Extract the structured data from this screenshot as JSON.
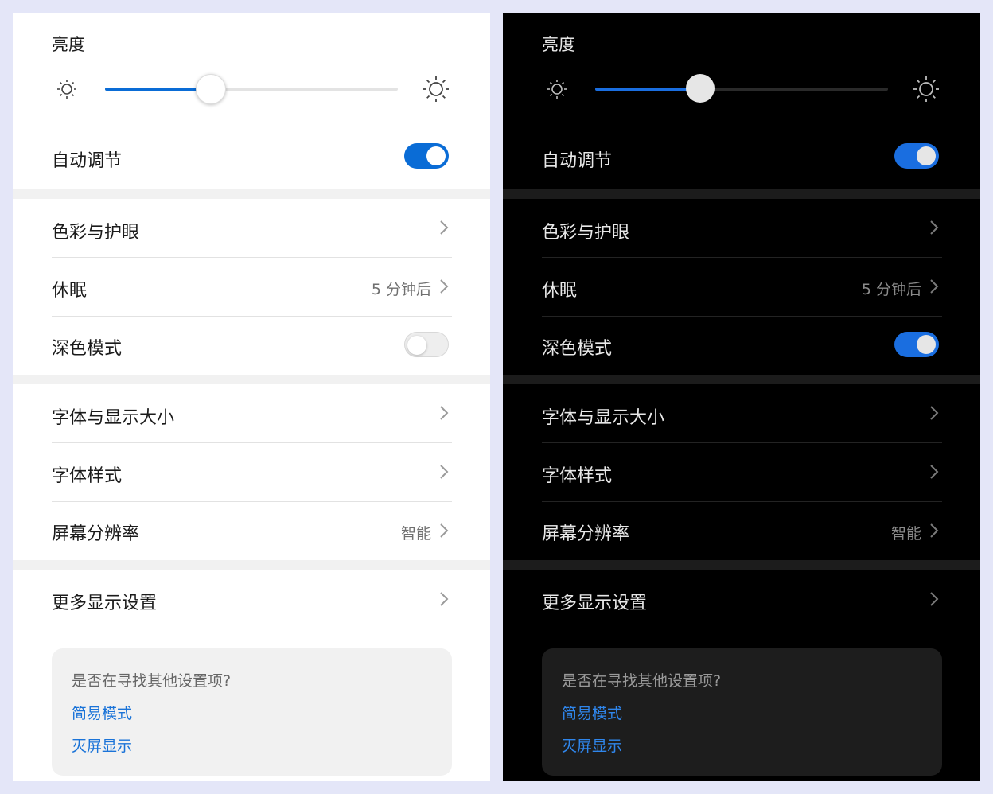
{
  "panels": [
    {
      "theme": "light",
      "brightness": {
        "label": "亮度",
        "level": 0.36
      },
      "auto_adjust": {
        "label": "自动调节",
        "on": true
      },
      "color_eye": {
        "label": "色彩与护眼"
      },
      "sleep": {
        "label": "休眠",
        "value": "5 分钟后"
      },
      "dark_mode": {
        "label": "深色模式",
        "on": false
      },
      "font_display_size": {
        "label": "字体与显示大小"
      },
      "font_style": {
        "label": "字体样式"
      },
      "resolution": {
        "label": "屏幕分辨率",
        "value": "智能"
      },
      "more_display": {
        "label": "更多显示设置"
      },
      "suggest": {
        "question": "是否在寻找其他设置项?",
        "link1": "简易模式",
        "link2": "灭屏显示"
      }
    },
    {
      "theme": "dark",
      "brightness": {
        "label": "亮度",
        "level": 0.36
      },
      "auto_adjust": {
        "label": "自动调节",
        "on": true
      },
      "color_eye": {
        "label": "色彩与护眼"
      },
      "sleep": {
        "label": "休眠",
        "value": "5 分钟后"
      },
      "dark_mode": {
        "label": "深色模式",
        "on": true
      },
      "font_display_size": {
        "label": "字体与显示大小"
      },
      "font_style": {
        "label": "字体样式"
      },
      "resolution": {
        "label": "屏幕分辨率",
        "value": "智能"
      },
      "more_display": {
        "label": "更多显示设置"
      },
      "suggest": {
        "question": "是否在寻找其他设置项?",
        "link1": "简易模式",
        "link2": "灭屏显示"
      }
    }
  ],
  "icons": {
    "brightness_low": "sun-small-icon",
    "brightness_high": "sun-large-icon",
    "chevron": "chevron-right-icon"
  },
  "colors": {
    "accent": "#0a6cd6",
    "link": "#1a73d8"
  }
}
